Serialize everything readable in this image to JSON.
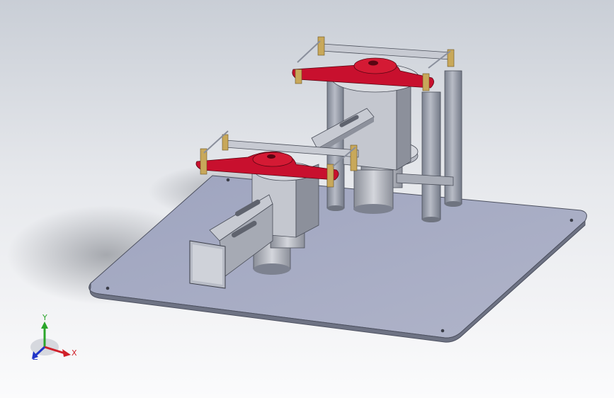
{
  "viewport": {
    "background_top": "#c9ced6",
    "background_bottom": "#fbfbfc"
  },
  "model": {
    "plate_color": "#a4a9c1",
    "arm_color": "#c8102e",
    "metal_color": "#b7b9bf",
    "column_color": "#9aa0ae"
  },
  "triad": {
    "x_label": "X",
    "y_label": "Y",
    "z_label": "Z",
    "x_color": "#d0202a",
    "y_color": "#2aa52a",
    "z_color": "#2035c8"
  }
}
